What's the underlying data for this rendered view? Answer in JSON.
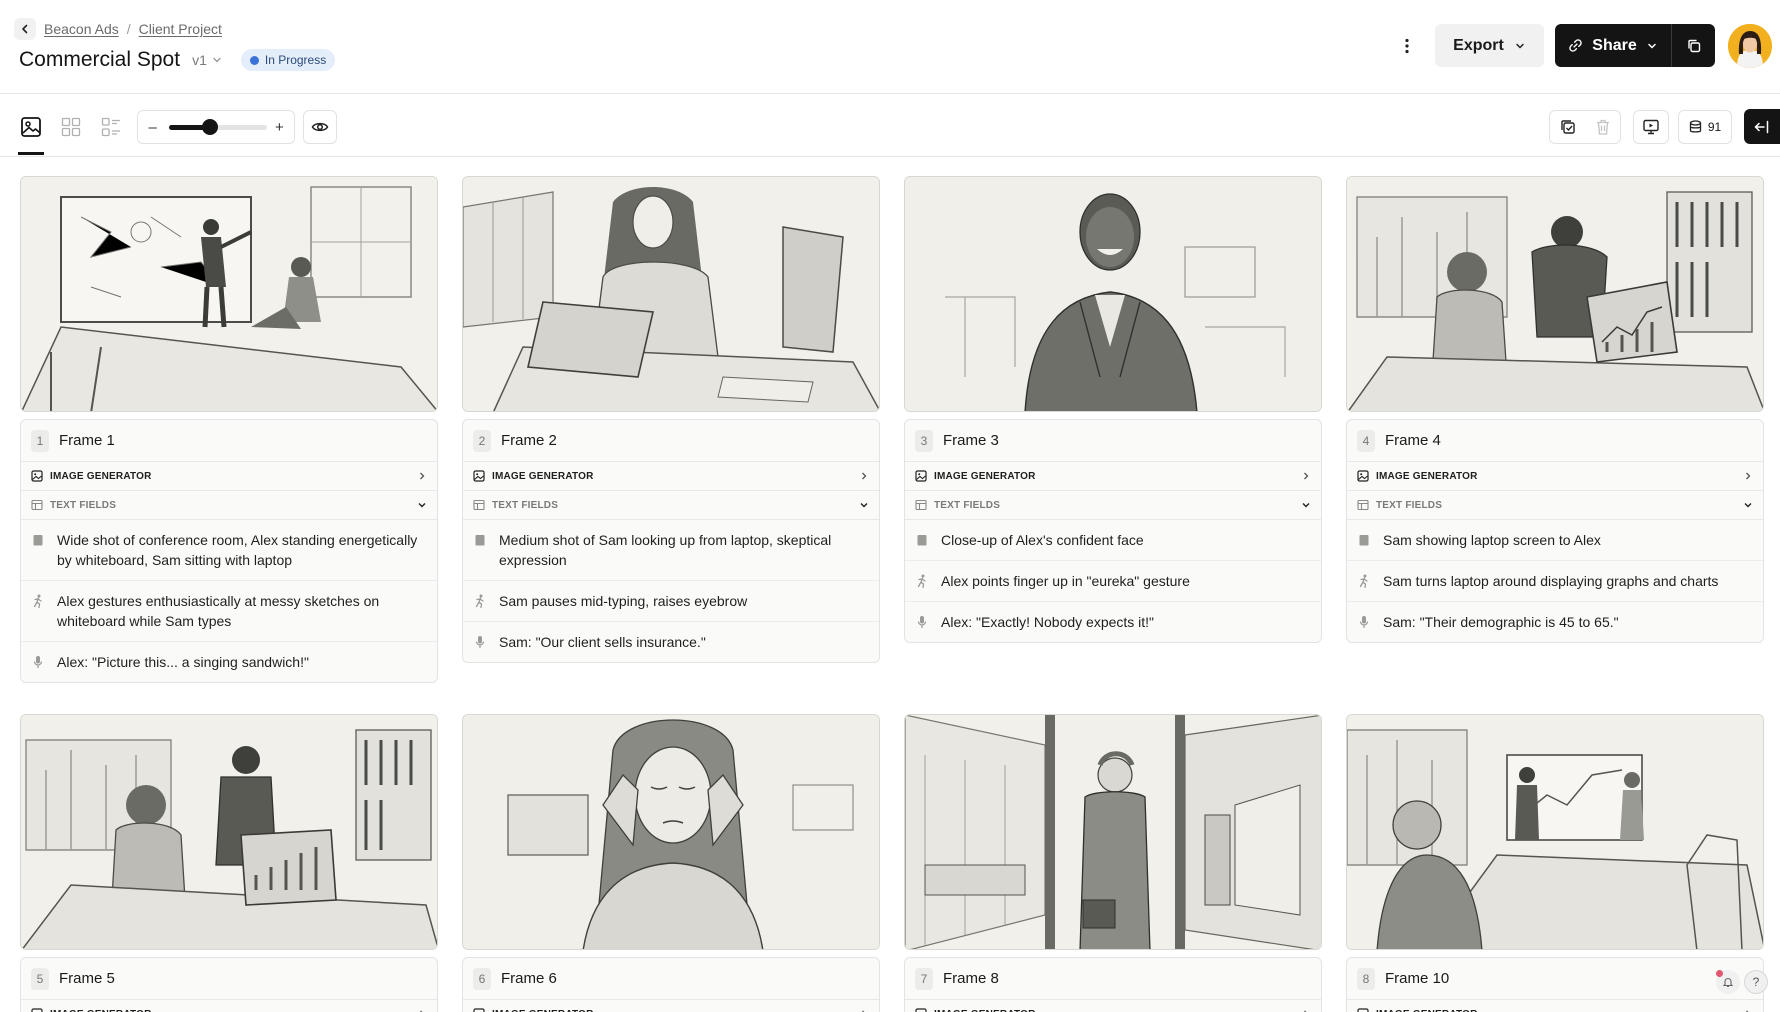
{
  "breadcrumb": {
    "org": "Beacon Ads",
    "separator": "/",
    "project": "Client Project"
  },
  "document": {
    "title": "Commercial Spot",
    "version": "v1",
    "status": "In Progress",
    "status_color": "#3b72d9"
  },
  "header": {
    "export_label": "Export",
    "share_label": "Share"
  },
  "toolbar": {
    "zoom_level": 0.4,
    "credits": "91"
  },
  "section_labels": {
    "image_generator": "IMAGE GENERATOR",
    "text_fields": "TEXT FIELDS"
  },
  "frames": [
    {
      "index": "1",
      "name": "Frame 1",
      "shot": "Wide shot of conference room, Alex standing energetically by whiteboard, Sam sitting with laptop",
      "action": "Alex gestures enthusiastically at messy sketches on whiteboard while Sam types",
      "dialogue": "Alex: \"Picture this... a singing sandwich!\""
    },
    {
      "index": "2",
      "name": "Frame 2",
      "shot": "Medium shot of Sam looking up from laptop, skeptical expression",
      "action": "Sam pauses mid-typing, raises eyebrow",
      "dialogue": "Sam: \"Our client sells insurance.\""
    },
    {
      "index": "3",
      "name": "Frame 3",
      "shot": "Close-up of Alex's confident face",
      "action": "Alex points finger up in \"eureka\" gesture",
      "dialogue": "Alex: \"Exactly! Nobody expects it!\""
    },
    {
      "index": "4",
      "name": "Frame 4",
      "shot": "Sam showing laptop screen to Alex",
      "action": "Sam turns laptop around displaying graphs and charts",
      "dialogue": "Sam: \"Their demographic is 45 to 65.\""
    },
    {
      "index": "5",
      "name": "Frame 5"
    },
    {
      "index": "6",
      "name": "Frame 6"
    },
    {
      "index": "7",
      "name": "Frame 8"
    },
    {
      "index": "8",
      "name": "Frame 10"
    }
  ],
  "help": {
    "label": "?"
  }
}
